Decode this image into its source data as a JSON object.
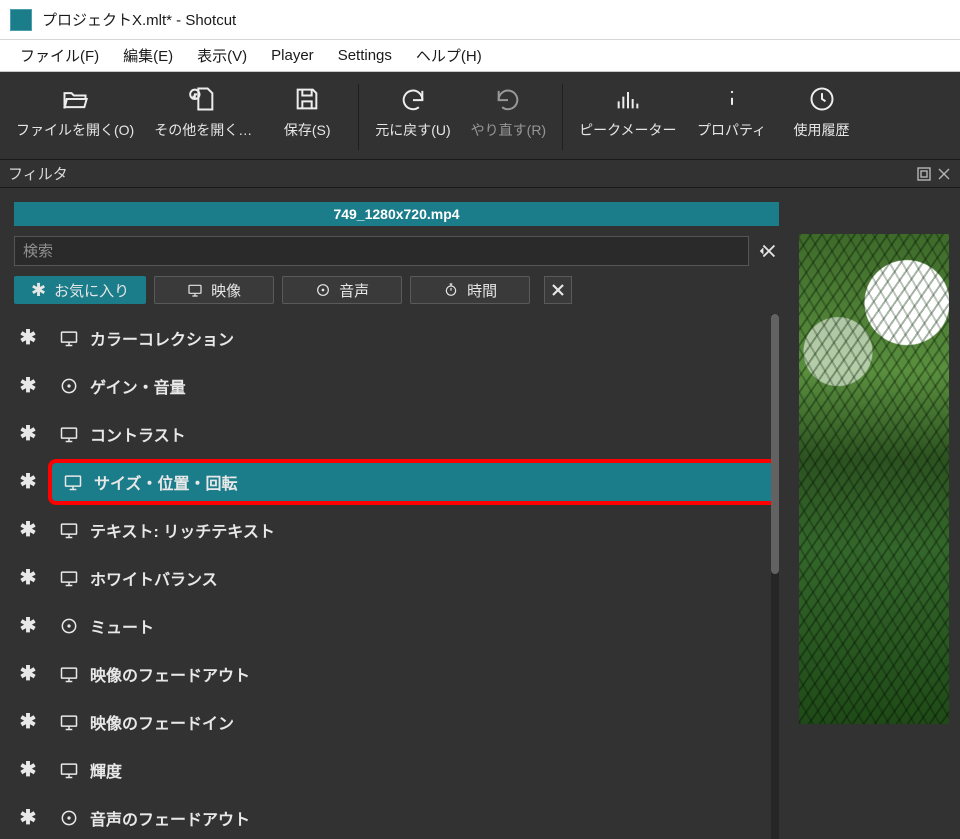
{
  "window": {
    "title": "プロジェクトX.mlt* - Shotcut"
  },
  "menubar": {
    "file": "ファイル(F)",
    "edit": "編集(E)",
    "view": "表示(V)",
    "player": "Player",
    "settings": "Settings",
    "help": "ヘルプ(H)"
  },
  "toolbar": {
    "open": "ファイルを開く(O)",
    "openother": "その他を開く…",
    "save": "保存(S)",
    "undo": "元に戻す(U)",
    "redo": "やり直す(R)",
    "peakmeter": "ピークメーター",
    "properties": "プロパティ",
    "history": "使用履歴"
  },
  "panel": {
    "title": "フィルタ"
  },
  "clip": {
    "name": "749_1280x720.mp4"
  },
  "search": {
    "placeholder": "検索",
    "value": ""
  },
  "categories": {
    "favorite": "お気に入り",
    "video": "映像",
    "audio": "音声",
    "time": "時間"
  },
  "filters": [
    {
      "type": "video",
      "label": "カラーコレクション"
    },
    {
      "type": "audio",
      "label": "ゲイン・音量"
    },
    {
      "type": "video",
      "label": "コントラスト"
    },
    {
      "type": "video",
      "label": "サイズ・位置・回転",
      "selected": true
    },
    {
      "type": "video",
      "label": "テキスト: リッチテキスト"
    },
    {
      "type": "video",
      "label": "ホワイトバランス"
    },
    {
      "type": "audio",
      "label": "ミュート"
    },
    {
      "type": "video",
      "label": "映像のフェードアウト"
    },
    {
      "type": "video",
      "label": "映像のフェードイン"
    },
    {
      "type": "video",
      "label": "輝度"
    },
    {
      "type": "audio",
      "label": "音声のフェードアウト"
    }
  ],
  "colors": {
    "accent": "#1b7c8a",
    "bg": "#323232",
    "highlight": "#ff0000"
  }
}
